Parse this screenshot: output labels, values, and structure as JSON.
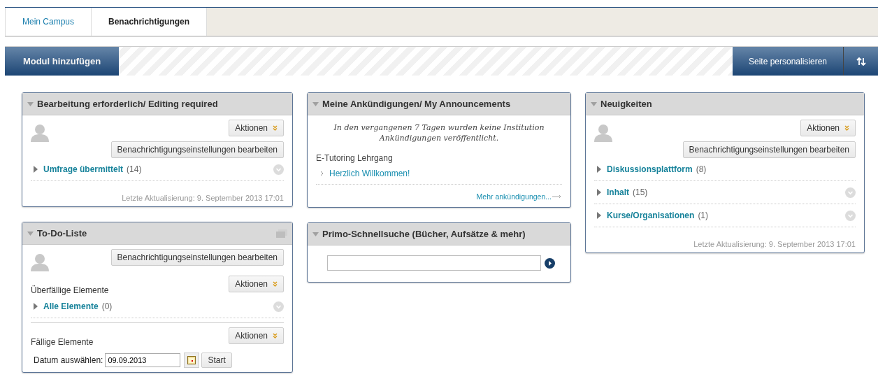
{
  "tabs": [
    {
      "label": "Mein Campus",
      "selected": false
    },
    {
      "label": "Benachrichtigungen",
      "selected": true
    }
  ],
  "toolbar": {
    "add_button": "Modul hinzufügen",
    "personalize_button": "Seite personalisieren"
  },
  "columns": [
    [
      {
        "title": "Bearbeitung erforderlich/ Editing required",
        "menu_icon": false,
        "blocks": [
          {
            "kind": "avatar_actions",
            "actions": "Aktionen",
            "settings": "Benachrichtigungseinstellungen bearbeiten"
          },
          {
            "kind": "section",
            "label": "Umfrage übermittelt",
            "count": "(14)",
            "has_menu": true
          },
          {
            "kind": "footer",
            "text": "Letzte Aktualisierung: 9. September 2013 17:01"
          }
        ]
      },
      {
        "title": "To-Do-Liste",
        "menu_icon": true,
        "blocks": [
          {
            "kind": "avatar_actions",
            "settings": "Benachrichtigungseinstellungen bearbeiten"
          },
          {
            "kind": "subheading_actions",
            "label": "Überfällige Elemente",
            "actions": "Aktionen"
          },
          {
            "kind": "section",
            "label": "Alle Elemente",
            "count": "(0)",
            "has_menu": true
          },
          {
            "kind": "divider"
          },
          {
            "kind": "subheading_actions",
            "label": "Fällige Elemente",
            "actions": "Aktionen"
          },
          {
            "kind": "date_row",
            "label": "Datum auswählen:",
            "value": "09.09.2013",
            "button": "Start"
          }
        ]
      }
    ],
    [
      {
        "title": "Meine Ankündigungen/ My Announcements",
        "menu_icon": false,
        "blocks": [
          {
            "kind": "notice",
            "text": "In den vergangenen 7 Tagen wurden keine Institution Ankündigungen veröffentlicht."
          },
          {
            "kind": "heading",
            "text": "E-Tutoring Lehrgang"
          },
          {
            "kind": "link",
            "text": "Herzlich Willkommen!"
          },
          {
            "kind": "more_link",
            "text": "Mehr ankündigungen..."
          }
        ]
      },
      {
        "title": "Primo-Schnellsuche (Bücher, Aufsätze & mehr)",
        "menu_icon": false,
        "blocks": [
          {
            "kind": "search"
          }
        ]
      }
    ],
    [
      {
        "title": "Neuigkeiten",
        "menu_icon": false,
        "blocks": [
          {
            "kind": "avatar_actions",
            "actions": "Aktionen",
            "settings": "Benachrichtigungseinstellungen bearbeiten"
          },
          {
            "kind": "section",
            "label": "Diskussionsplattform",
            "count": "(8)",
            "has_menu": false
          },
          {
            "kind": "section",
            "label": "Inhalt",
            "count": "(15)",
            "has_menu": true
          },
          {
            "kind": "section",
            "label": "Kurse/Organisationen",
            "count": "(1)",
            "has_menu": true
          },
          {
            "kind": "footer",
            "text": "Letzte Aktualisierung: 9. September 2013 17:01"
          }
        ]
      }
    ]
  ]
}
